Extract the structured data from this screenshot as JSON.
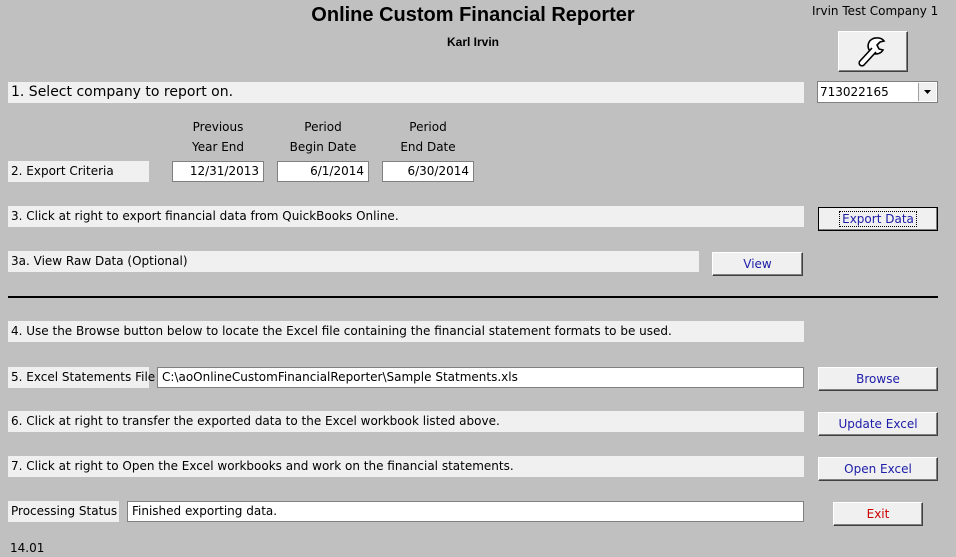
{
  "header": {
    "title": "Online Custom Financial Reporter",
    "subtitle": "Karl Irvin",
    "company_name": "Irvin Test Company 1"
  },
  "icons": {
    "tools": "wrench-icon",
    "dropdown": "chevron-down-icon"
  },
  "step1": {
    "label": "1. Select company to report on.",
    "company_id": "713022165"
  },
  "step2": {
    "label": "2. Export Criteria",
    "columns": [
      {
        "line1": "Previous",
        "line2": "Year End",
        "value": "12/31/2013"
      },
      {
        "line1": "Period",
        "line2": "Begin Date",
        "value": "6/1/2014"
      },
      {
        "line1": "Period",
        "line2": "End Date",
        "value": "6/30/2014"
      }
    ]
  },
  "step3": {
    "label": "3. Click at right to export financial data from QuickBooks Online.",
    "button": "Export Data"
  },
  "step3a": {
    "label": "3a. View Raw Data (Optional)",
    "button": "View"
  },
  "step4": {
    "label": "4.  Use the Browse button below to locate the Excel file containing the financial statement formats to be used."
  },
  "step5": {
    "label": "5. Excel Statements File",
    "value": "C:\\aoOnlineCustomFinancialReporter\\Sample Statments.xls",
    "button": "Browse"
  },
  "step6": {
    "label": "6. Click at right to transfer the exported data to the Excel workbook listed above.",
    "button": "Update Excel"
  },
  "step7": {
    "label": "7. Click at right to Open the Excel workbooks and work on the financial statements.",
    "button": "Open Excel"
  },
  "status": {
    "label": "Processing Status",
    "value": "Finished exporting data.",
    "exit_button": "Exit"
  },
  "footer": {
    "version": "14.01"
  },
  "colors": {
    "background": "#c0c0c0",
    "bar": "#f0f0f0",
    "button_text": "#1c1ca8",
    "exit_text": "#cc0000"
  }
}
